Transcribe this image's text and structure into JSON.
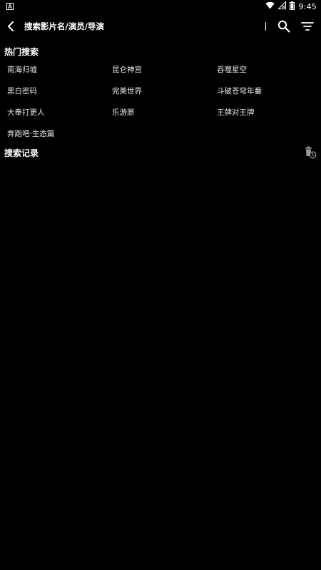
{
  "status_bar": {
    "time": "9:45",
    "icons": [
      "wifi-icon",
      "signal-icon",
      "battery-icon"
    ]
  },
  "search": {
    "placeholder": "搜索影片名/演员/导演"
  },
  "hot_search": {
    "title": "热门搜索",
    "rows": [
      [
        "南海归墟",
        "昆仑神宫",
        "吞噬星空"
      ],
      [
        "黑白密码",
        "完美世界",
        "斗破苍穹年番"
      ],
      [
        "大奉打更人",
        "乐游原",
        "王牌对王牌"
      ],
      [
        "奔跑吧·生态篇"
      ]
    ]
  },
  "history": {
    "title": "搜索记录"
  }
}
